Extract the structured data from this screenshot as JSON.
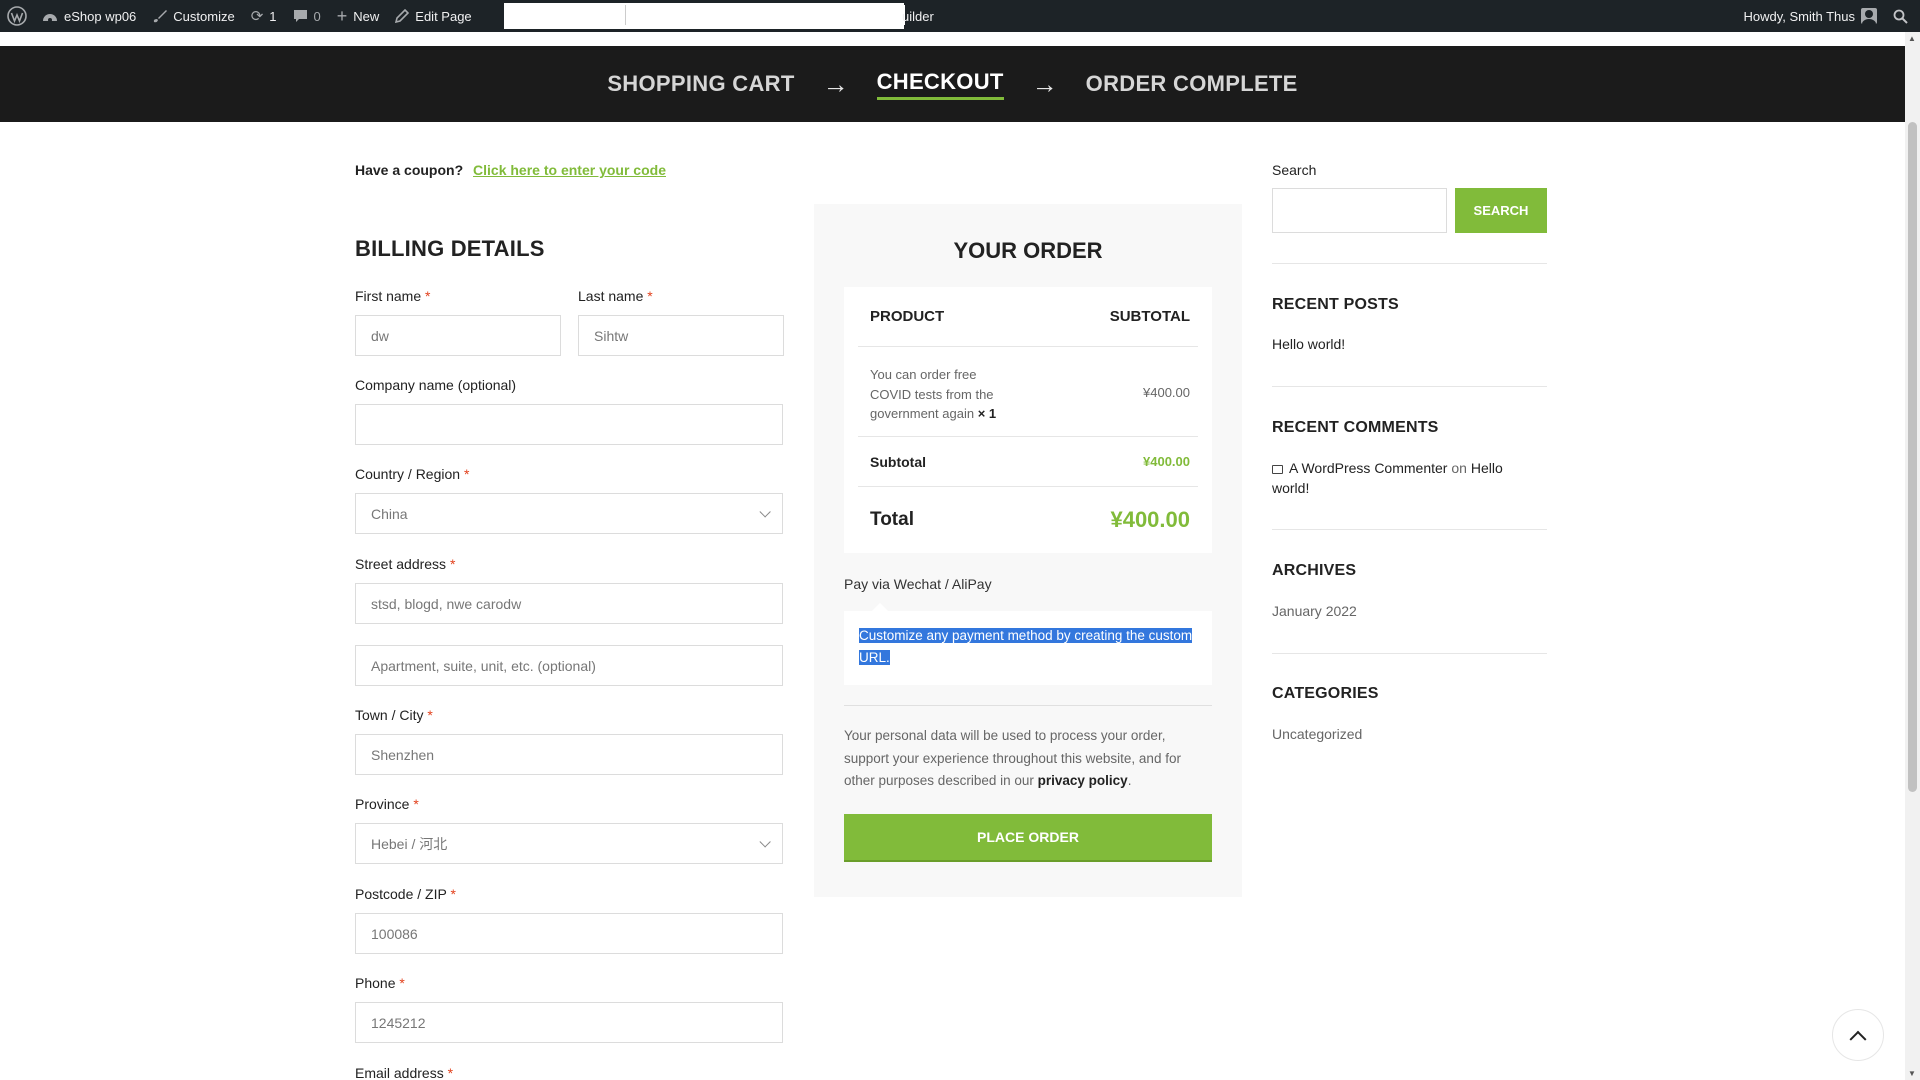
{
  "adminbar": {
    "site_name": "eShop wp06",
    "customize": "Customize",
    "updates_count": "1",
    "comments_count": "0",
    "new": "New",
    "edit_page": "Edit Page",
    "trail_text": "uilder",
    "howdy": "Howdy, Smith Thus"
  },
  "steps": {
    "cart": "SHOPPING CART",
    "checkout": "CHECKOUT",
    "complete": "ORDER COMPLETE",
    "arrow": "→"
  },
  "coupon": {
    "prompt": "Have a coupon?",
    "link": "Click here to enter your code"
  },
  "billing": {
    "title": "BILLING DETAILS",
    "required_mark": "*",
    "first_name": {
      "label": "First name",
      "value": "dw"
    },
    "last_name": {
      "label": "Last name",
      "value": "Sihtw"
    },
    "company": {
      "label": "Company name (optional)",
      "value": ""
    },
    "country": {
      "label": "Country / Region",
      "value": "China"
    },
    "street": {
      "label": "Street address",
      "value": "stsd, blogd, nwe carodw"
    },
    "street2": {
      "placeholder": "Apartment, suite, unit, etc. (optional)"
    },
    "city": {
      "label": "Town / City",
      "value": "Shenzhen"
    },
    "province": {
      "label": "Province",
      "value": "Hebei / 河北"
    },
    "postcode": {
      "label": "Postcode / ZIP",
      "value": "100086"
    },
    "phone": {
      "label": "Phone",
      "value": "1245212"
    },
    "email": {
      "label": "Email address"
    }
  },
  "order": {
    "title": "YOUR ORDER",
    "col_product": "PRODUCT",
    "col_subtotal": "SUBTOTAL",
    "item_name": "You can order free COVID tests from the government again",
    "item_qty": "× 1",
    "item_price": "¥400.00",
    "subtotal_label": "Subtotal",
    "subtotal_value": "¥400.00",
    "total_label": "Total",
    "total_value": "¥400.00",
    "payment_method": "Pay via Wechat / AliPay",
    "payment_desc": "Customize any payment method by creating the custom URL.",
    "privacy_text": "Your personal data will be used to process your order, support your experience throughout this website, and for other purposes described in our",
    "privacy_link": "privacy policy",
    "privacy_end": ".",
    "place_order": "PLACE ORDER"
  },
  "sidebar": {
    "search_label": "Search",
    "search_button": "SEARCH",
    "recent_posts_title": "RECENT POSTS",
    "recent_post": "Hello world!",
    "recent_comments_title": "RECENT COMMENTS",
    "comment_author": "A WordPress Commenter",
    "comment_on": "on",
    "comment_post": "Hello world!",
    "archives_title": "ARCHIVES",
    "archive_item": "January 2022",
    "categories_title": "CATEGORIES",
    "category_item": "Uncategorized"
  },
  "icons": {
    "wordpress": "wordpress-logo-icon",
    "dashboard": "dashboard-icon",
    "brush": "brush-icon",
    "updates": "refresh-icon",
    "comments": "comment-bubble-icon",
    "plus": "plus-icon",
    "pencil": "pencil-icon",
    "user": "user-avatar-icon",
    "search": "search-icon",
    "comment_small": "comment-icon",
    "back_to_top": "chevron-up-icon"
  },
  "colors": {
    "accent": "#81bb3a",
    "adminbar": "#1d2327",
    "steps_bar": "#1b1b1b",
    "required": "#e2401c",
    "selection": "#3377dd"
  }
}
